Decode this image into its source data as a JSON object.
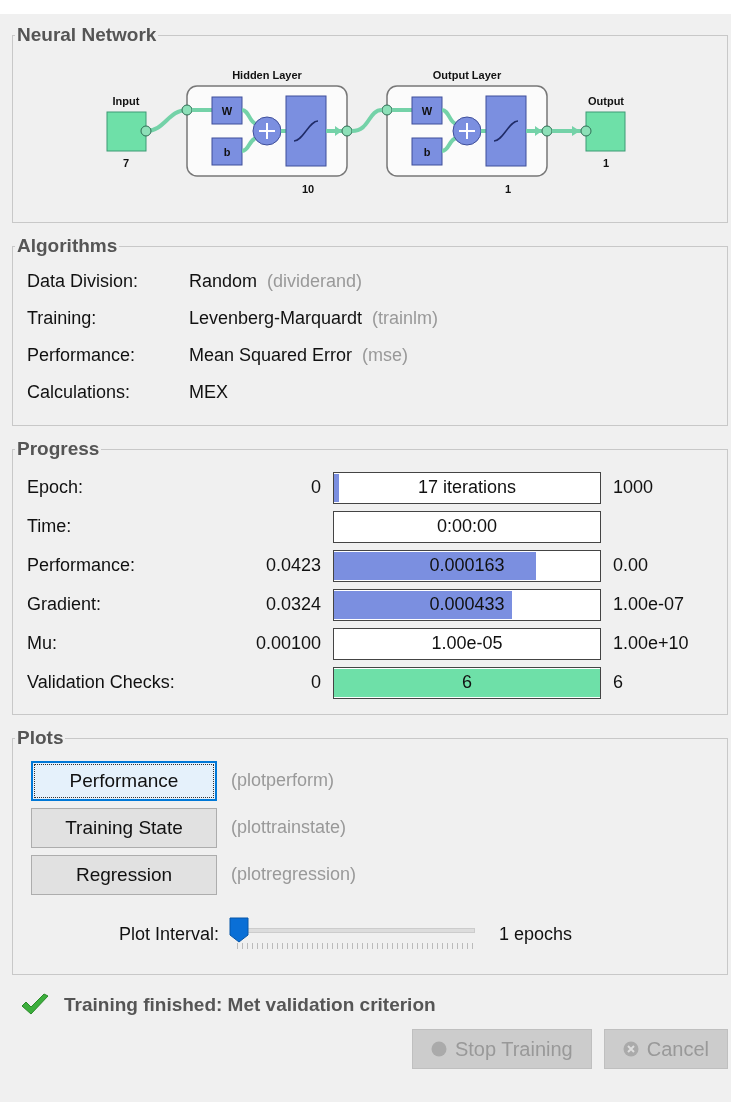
{
  "network": {
    "title": "Neural Network",
    "input": {
      "label": "Input",
      "size": "7"
    },
    "layers": [
      {
        "title": "Hidden Layer",
        "weight": "W",
        "bias": "b",
        "size": "10"
      },
      {
        "title": "Output Layer",
        "weight": "W",
        "bias": "b",
        "size": "1"
      }
    ],
    "output": {
      "label": "Output",
      "size": "1"
    }
  },
  "algorithms": {
    "title": "Algorithms",
    "rows": [
      {
        "label": "Data Division:",
        "value": "Random",
        "function": "(dividerand)"
      },
      {
        "label": "Training:",
        "value": "Levenberg-Marquardt",
        "function": "(trainlm)"
      },
      {
        "label": "Performance:",
        "value": "Mean Squared Error",
        "function": "(mse)"
      },
      {
        "label": "Calculations:",
        "value": "MEX"
      }
    ]
  },
  "progress": {
    "title": "Progress",
    "rows": [
      {
        "label": "Epoch:",
        "start": "0",
        "value": "17 iterations",
        "end": "1000",
        "level": 0.017,
        "kind": "bar"
      },
      {
        "label": "Time:",
        "value": "0:00:00",
        "kind": "field"
      },
      {
        "label": "Performance:",
        "start": "0.0423",
        "value": "0.000163",
        "end": "0.00",
        "level": 0.76,
        "kind": "bar"
      },
      {
        "label": "Gradient:",
        "start": "0.0324",
        "value": "0.000433",
        "end": "1.00e-07",
        "level": 0.67,
        "kind": "bar"
      },
      {
        "label": "Mu:",
        "start": "0.00100",
        "value": "1.00e-05",
        "end": "1.00e+10",
        "kind": "field"
      },
      {
        "label": "Validation Checks:",
        "start": "0",
        "value": "6",
        "end": "6",
        "level": 1,
        "kind": "check"
      }
    ]
  },
  "plots": {
    "title": "Plots",
    "buttons": [
      {
        "label": "Performance",
        "function": "(plotperform)",
        "selected": true
      },
      {
        "label": "Training State",
        "function": "(plottrainstate)",
        "selected": false
      },
      {
        "label": "Regression",
        "function": "(plotregression)",
        "selected": false
      }
    ],
    "interval": {
      "label": "Plot Interval:",
      "level": 0,
      "reading": "1 epochs"
    }
  },
  "status": {
    "text": "Training finished: Met validation criterion"
  },
  "buttons": [
    {
      "label": "Stop Training",
      "kind": "stop",
      "disabled": true
    },
    {
      "label": "Cancel",
      "kind": "cancel",
      "disabled": true
    }
  ]
}
